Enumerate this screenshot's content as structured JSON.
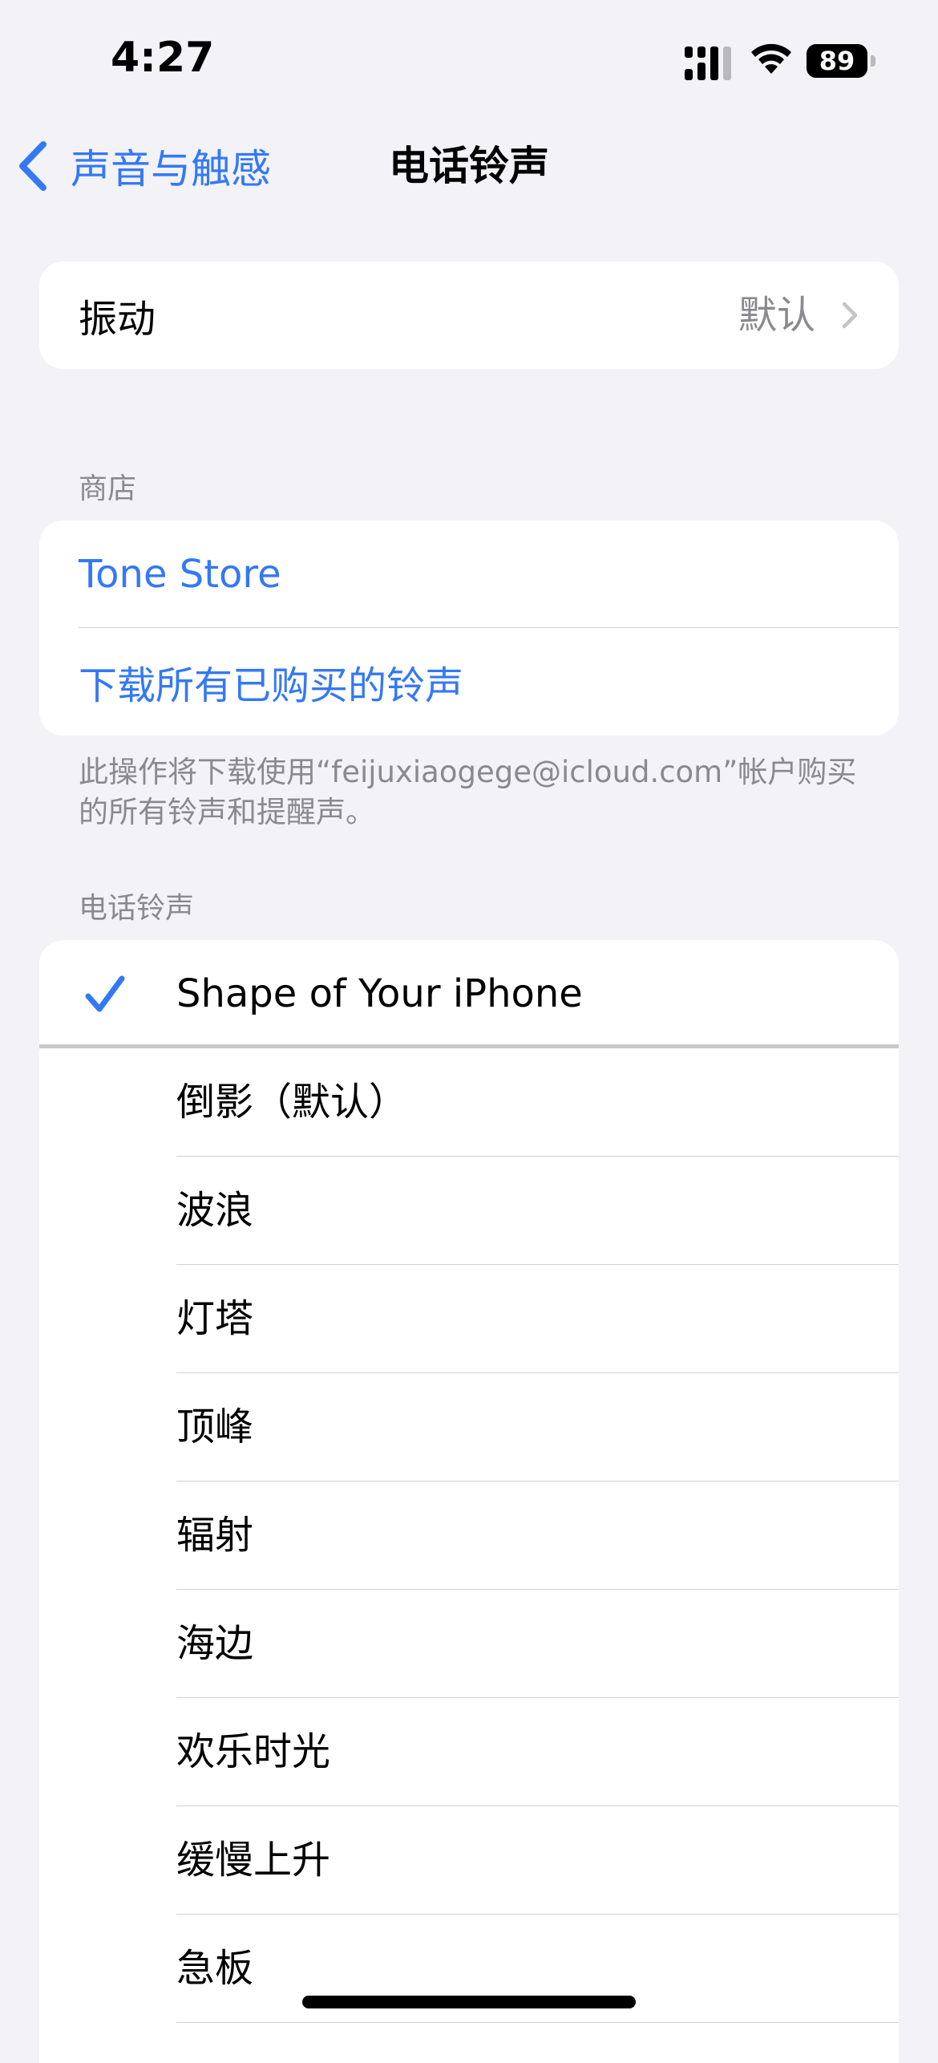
{
  "status_bar": {
    "time": "4:27",
    "battery_level": "89",
    "icons": [
      "cellular-signal-icon",
      "wifi-icon",
      "battery-icon"
    ]
  },
  "nav": {
    "back_label": "声音与触感",
    "title": "电话铃声",
    "icons": [
      "chevron-left-icon"
    ]
  },
  "vibration": {
    "label": "振动",
    "value": "默认",
    "icons": [
      "chevron-right-icon"
    ]
  },
  "store": {
    "header": "商店",
    "tone_store": "Tone Store",
    "download_all": "下载所有已购买的铃声",
    "footer": "此操作将下载使用“feijuxiaogege@icloud.com”帐户购买的所有铃声和提醒声。"
  },
  "ringtones": {
    "header": "电话铃声",
    "selected_index": 0,
    "items": [
      "Shape of Your iPhone",
      "倒影（默认）",
      "波浪",
      "灯塔",
      "顶峰",
      "辐射",
      "海边",
      "欢乐时光",
      "缓慢上升",
      "急板"
    ]
  },
  "colors": {
    "accent": "#3478f6",
    "background": "#f2f2f7",
    "secondary_text": "#8a8a8e"
  }
}
